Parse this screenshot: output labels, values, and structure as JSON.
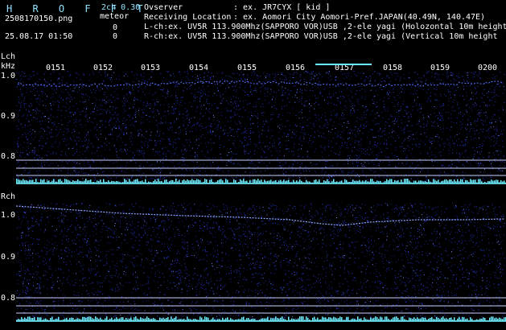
{
  "header": {
    "brand": "H R O F F T",
    "version": "2ch 0.30",
    "file": "2508170150.png",
    "meteor_label": "meteor",
    "meteor_count_1": "0",
    "datetime": "25.08.17 01:50",
    "meteor_count_2": "0",
    "observer_label": "Ovserver",
    "observer_value": ": ex. JR7CYX [ kid ]",
    "location_label": "Receiving Location",
    "location_value": ": ex. Aomori City Aomori-Pref.JAPAN(40.49N, 140.47E)",
    "lch_desc": "L-ch:ex. UV5R 113.900Mhz(SAPPORO VOR)USB ,2-ele yagi (Holozontal 10m height",
    "rch_desc": "R-ch:ex. UV5R 113.900Mhz(SAPPORO VOR)USB ,2-ele yagi (Vertical 10m height"
  },
  "axis": {
    "lch_label": "Lch",
    "khz_label": "kHz",
    "rch_label": "Rch",
    "time_ticks": [
      "0151",
      "0152",
      "0153",
      "0154",
      "0155",
      "0156",
      "0157",
      "0158",
      "0159",
      "0200"
    ],
    "freq_ticks": [
      "1.0",
      "0.9",
      "0.8"
    ]
  },
  "colors": {
    "background": "#000000",
    "text": "#ffffff",
    "accent": "#8fe3ff",
    "noise": "#2b3bd6",
    "signal": "#7fa8ff",
    "bar": "#6ff0ff"
  }
}
